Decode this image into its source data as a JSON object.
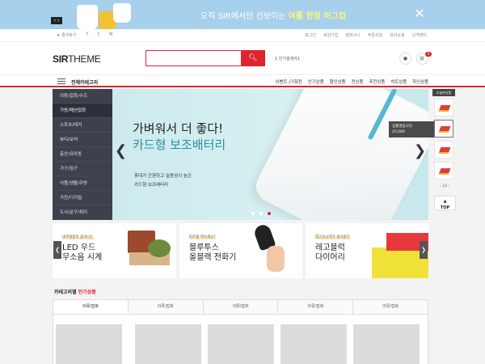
{
  "promo": {
    "text_plain": "오직 SIR에서만 선보이는 ",
    "text_bold": "여름 한정 머그컵",
    "close_icon": "close-icon",
    "slider_icon": "prev-next-icon",
    "colors": {
      "background": "#a6d0ec",
      "highlight": "#fff37a"
    }
  },
  "util": {
    "favorite": "즐겨찾기",
    "social": [
      "f",
      "t",
      "N"
    ],
    "links": [
      "로그인",
      "회원가입",
      "장바구니",
      "주문조회",
      "마이쇼핑",
      "고객센터"
    ]
  },
  "header": {
    "logo_bold": "SIR",
    "logo_rest": "THEME",
    "search_value": "",
    "search_icon": "search-icon",
    "popular_keyword": "1  인기검색어1",
    "user_icon": "user-icon",
    "cart_icon": "cart-icon",
    "cart_count": "0",
    "accent": "#e0232d"
  },
  "nav": {
    "all_categories": "전체카테고리",
    "menu": [
      "이벤트 /기획전",
      "인기상품",
      "할인상품",
      "전상품",
      "추천상품",
      "히트상품",
      "최신상품"
    ]
  },
  "categories": [
    "의류/잡화/수즈",
    "가방/패션잡화",
    "스포츠/레저",
    "뷰티/보석",
    "출산/유아동",
    "가구/침구",
    "식품/생활/주방",
    "가전/디지털",
    "도서/문구/취미"
  ],
  "slider": {
    "title": "가벼워서 더 좋다!",
    "subtitle": "카드형 보조배터리",
    "desc_line1": "휴대가 간편하고 실용성이 높은",
    "desc_line2": "카드형 보조배터리",
    "current_slide": 3,
    "total_slides": 3
  },
  "today": {
    "label": "오늘본상품",
    "tooltip_name": "상품명입니다",
    "tooltip_price": "25,000",
    "page": "1/2",
    "top": "TOP"
  },
  "cards": [
    {
      "tag": "네추럴함이 묻어나는",
      "title_line1": "LED 우드",
      "title_line2": "무소음 시계"
    },
    {
      "tag": "따르릉 여보세요?",
      "title_line1": "블루투스",
      "title_line2": "올블랙 전화기"
    },
    {
      "tag": "레고의시대가 돌아왔다",
      "title_line1": "레고블럭",
      "title_line2": "다이어리"
    }
  ],
  "popular_section": {
    "title_plain": "카테고리별 ",
    "title_red": "인기상품",
    "tabs": [
      "의류/잡화",
      "의류/잡화",
      "의류/잡화",
      "의류/잡화",
      "의류/잡화"
    ]
  }
}
